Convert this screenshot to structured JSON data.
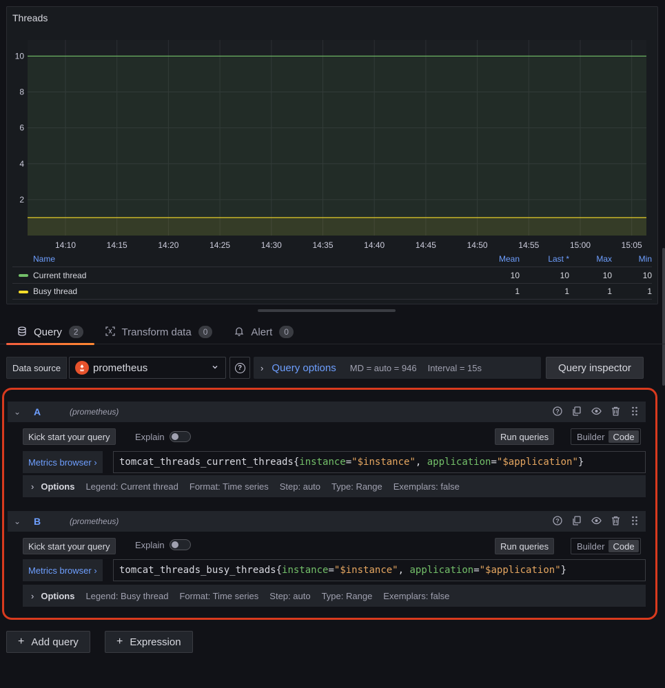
{
  "panel": {
    "title": "Threads"
  },
  "chart_data": {
    "type": "line",
    "title": "Threads",
    "x": [
      "14:10",
      "14:15",
      "14:20",
      "14:25",
      "14:30",
      "14:35",
      "14:40",
      "14:45",
      "14:50",
      "14:55",
      "15:00",
      "15:05"
    ],
    "yticks": [
      "2",
      "4",
      "6",
      "8",
      "10"
    ],
    "ylim": [
      0,
      10.9
    ],
    "series": [
      {
        "name": "Current thread",
        "value": 10,
        "color": "#73bf69"
      },
      {
        "name": "Busy thread",
        "value": 1,
        "color": "#fade2a"
      }
    ],
    "grid": true,
    "legend": "bottom-table"
  },
  "legend": {
    "headers": {
      "name": "Name",
      "mean": "Mean",
      "last": "Last *",
      "max": "Max",
      "min": "Min"
    },
    "rows": [
      {
        "name": "Current thread",
        "color": "#73bf69",
        "mean": "10",
        "last": "10",
        "max": "10",
        "min": "10"
      },
      {
        "name": "Busy thread",
        "color": "#fade2a",
        "mean": "1",
        "last": "1",
        "max": "1",
        "min": "1"
      }
    ]
  },
  "tabs": [
    {
      "label": "Query",
      "count": "2",
      "icon": "database-icon"
    },
    {
      "label": "Transform data",
      "count": "0",
      "icon": "transform-icon"
    },
    {
      "label": "Alert",
      "count": "0",
      "icon": "bell-icon"
    }
  ],
  "toolbar": {
    "ds_label": "Data source",
    "ds_value": "prometheus",
    "qopts_title": "Query options",
    "md": "MD = auto = 946",
    "interval": "Interval = 15s",
    "inspector": "Query inspector"
  },
  "queries": [
    {
      "letter": "A",
      "ds": "(prometheus)",
      "kick": "Kick start your query",
      "explain": "Explain",
      "run": "Run queries",
      "builder": "Builder",
      "code": "Code",
      "metrics_browser": "Metrics browser ›",
      "expr_metric": "tomcat_threads_current_threads{",
      "expr_l1": "instance",
      "expr_v1": "\"$instance\"",
      "expr_l2": "application",
      "expr_v2": "\"$application\"",
      "options": "Options",
      "legend": "Legend: Current thread",
      "format": "Format: Time series",
      "step": "Step: auto",
      "type": "Type: Range",
      "exemplars": "Exemplars: false"
    },
    {
      "letter": "B",
      "ds": "(prometheus)",
      "kick": "Kick start your query",
      "explain": "Explain",
      "run": "Run queries",
      "builder": "Builder",
      "code": "Code",
      "metrics_browser": "Metrics browser ›",
      "expr_metric": "tomcat_threads_busy_threads{",
      "expr_l1": "instance",
      "expr_v1": "\"$instance\"",
      "expr_l2": "application",
      "expr_v2": "\"$application\"",
      "options": "Options",
      "legend": "Legend: Busy thread",
      "format": "Format: Time series",
      "step": "Step: auto",
      "type": "Type: Range",
      "exemplars": "Exemplars: false"
    }
  ],
  "actions": {
    "add_query": "Add query",
    "expression": "Expression"
  }
}
